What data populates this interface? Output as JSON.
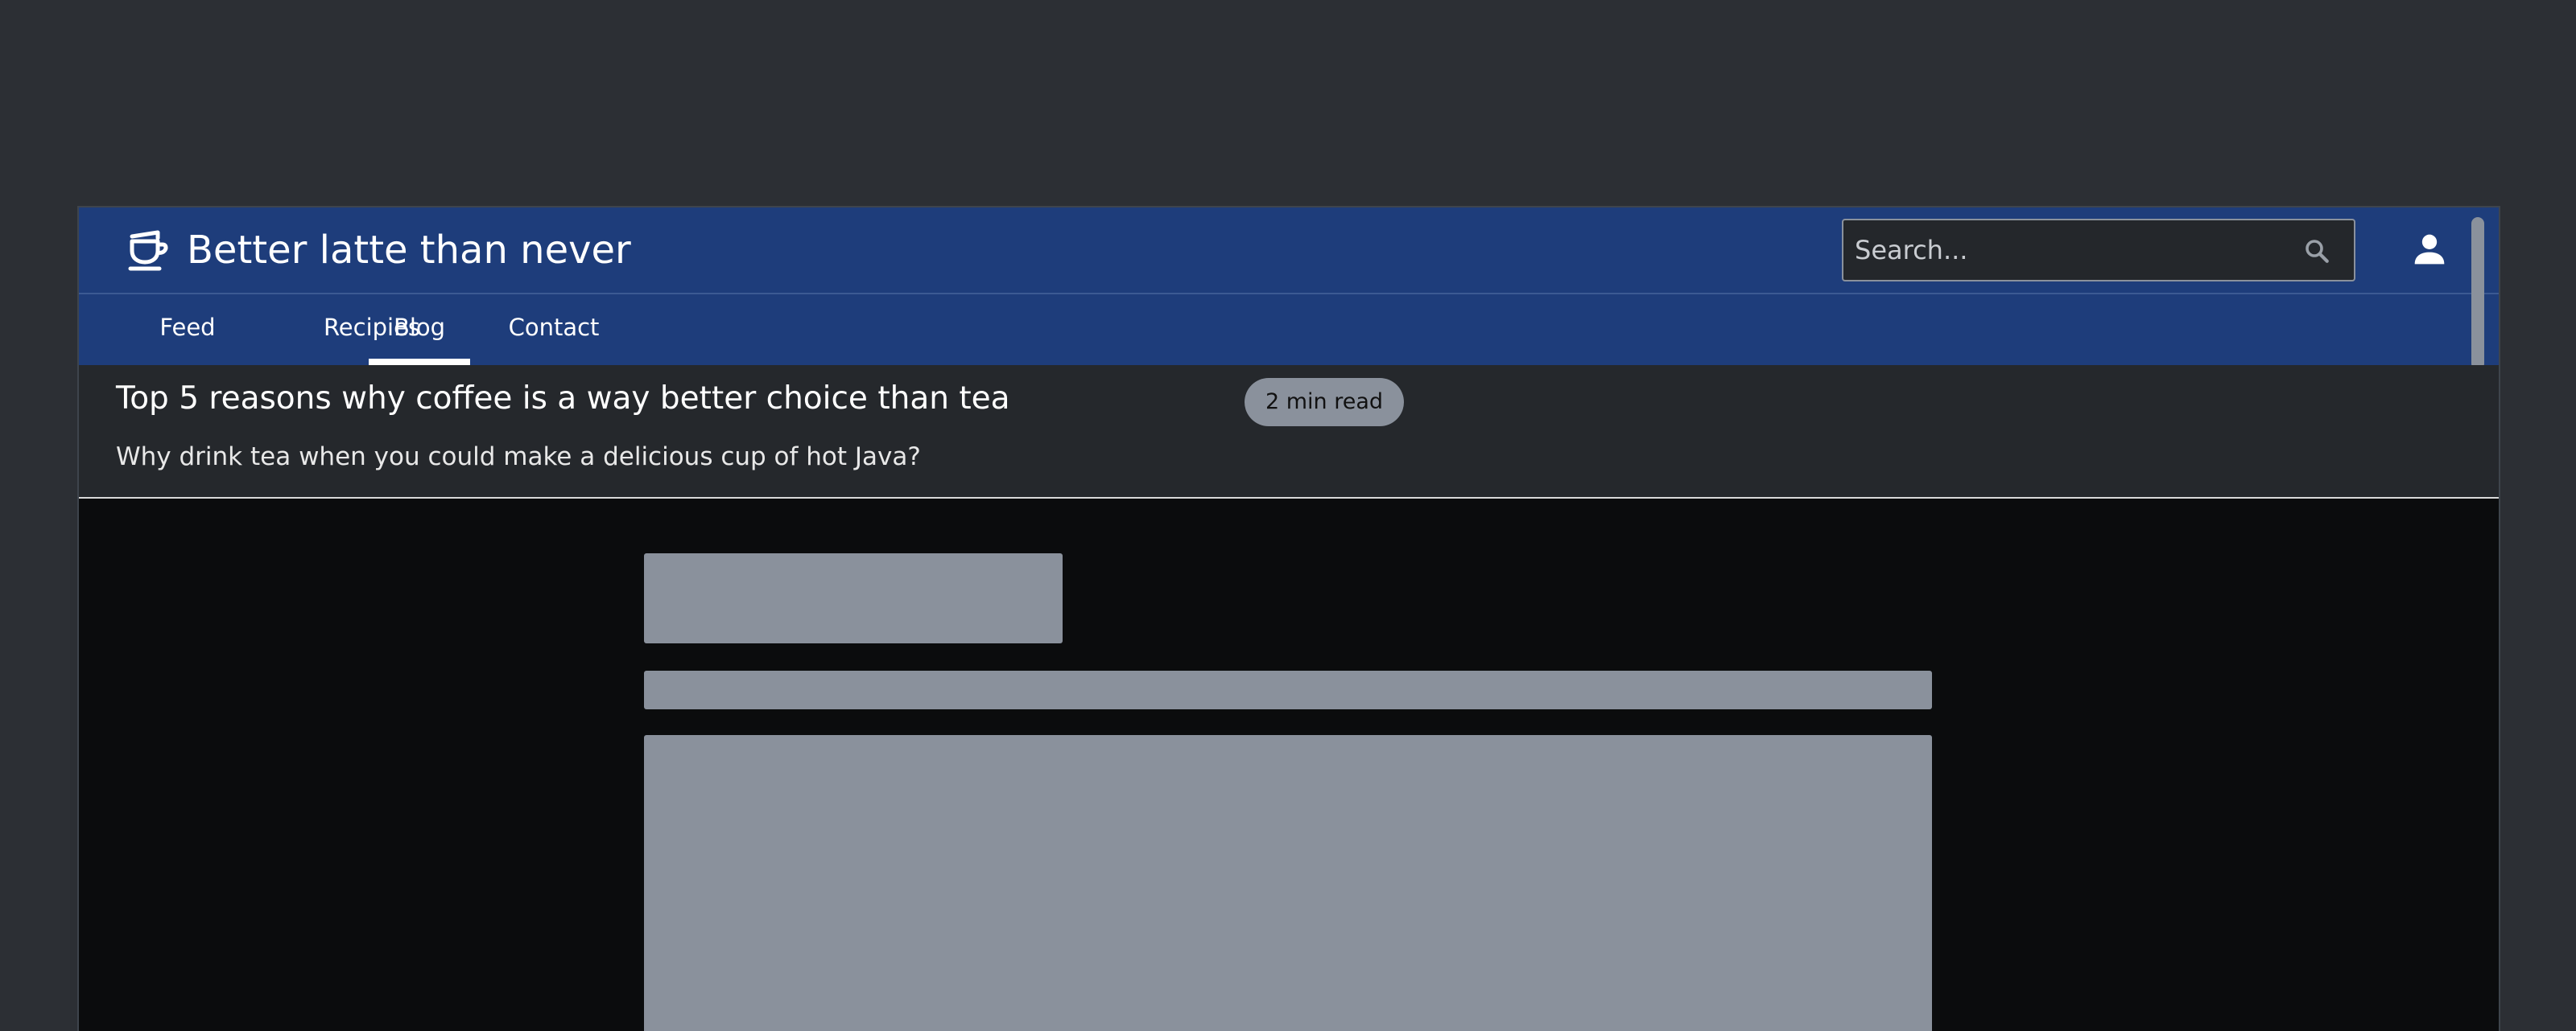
{
  "app": {
    "brand_title": "Better latte than never",
    "logo_icon": "coffee-cup-icon"
  },
  "search": {
    "placeholder": "Search...",
    "value": "",
    "icon": "search-icon"
  },
  "user": {
    "icon": "user-icon"
  },
  "nav": {
    "tabs": [
      {
        "label": "Feed",
        "active": false
      },
      {
        "label": "Recipies",
        "active": false
      },
      {
        "label": "Blog",
        "active": true
      },
      {
        "label": "Contact",
        "active": false
      }
    ]
  },
  "article": {
    "title": "Top 5 reasons why coffee is a way better choice than tea",
    "read_time": "2 min read",
    "subtitle": "Why drink tea when you could make a delicious cup of hot Java?"
  },
  "colors": {
    "page_background": "#2c2f34",
    "header_blue": "#1e3d7b",
    "article_header_bg": "#25282c",
    "content_bg": "#0b0c0d",
    "skeleton_gray": "#8a919c"
  }
}
